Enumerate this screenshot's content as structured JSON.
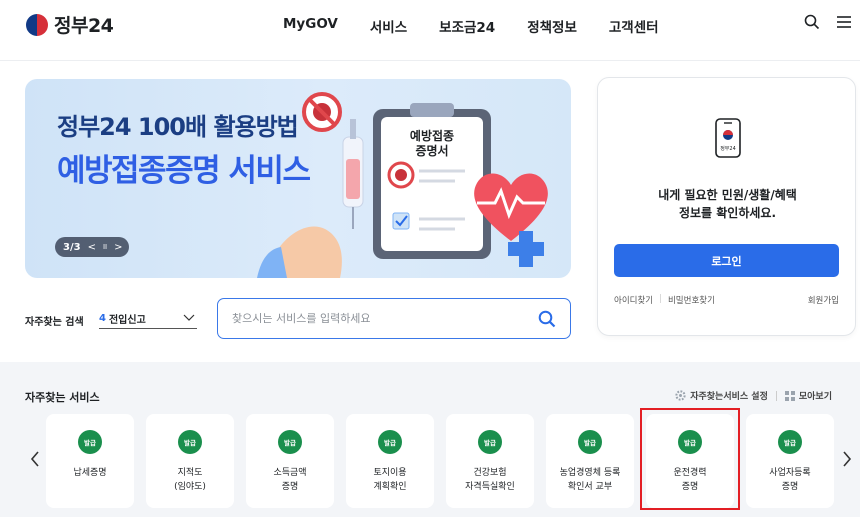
{
  "header": {
    "logo_text": "정부24",
    "nav": [
      "MyGOV",
      "서비스",
      "보조금24",
      "정책정보",
      "고객센터"
    ]
  },
  "banner": {
    "title_line1": "정부24 100배 활용방법",
    "title_line2": "예방접종증명 서비스",
    "clipboard_text": "예방접종\n증명서",
    "slide_counter": "3/3",
    "prev_symbol": "<",
    "pause_symbol": "II",
    "next_symbol": ">"
  },
  "login": {
    "phone_label": "정부24",
    "message_line1": "내게 필요한 민원/생활/혜택",
    "message_line2": "정보를 확인하세요.",
    "button_label": "로그인",
    "find_id": "아이디찾기",
    "find_pw": "비밀번호찾기",
    "join": "회원가입"
  },
  "search": {
    "fav_label": "자주찾는 검색",
    "selected_num": "4",
    "selected_label": "전입신고",
    "placeholder": "찾으시는 서비스를 입력하세요"
  },
  "services": {
    "title": "자주찾는 서비스",
    "settings_label": "자주찾는서비스 설정",
    "view_all_label": "모아보기",
    "items": [
      {
        "badge": "발급",
        "name": "납세증명"
      },
      {
        "badge": "발급",
        "name": "지적도\n(임야도)"
      },
      {
        "badge": "발급",
        "name": "소득금액\n증명"
      },
      {
        "badge": "발급",
        "name": "토지이용\n계획확인"
      },
      {
        "badge": "발급",
        "name": "건강보험\n자격득실확인"
      },
      {
        "badge": "발급",
        "name": "농업경영체 등록\n확인서 교부"
      },
      {
        "badge": "발급",
        "name": "운전경력\n증명"
      },
      {
        "badge": "발급",
        "name": "사업자등록\n증명"
      }
    ]
  },
  "colors": {
    "primary_blue": "#2a6ce8",
    "badge_green": "#1a8f4d",
    "highlight_red": "#e31e24"
  }
}
